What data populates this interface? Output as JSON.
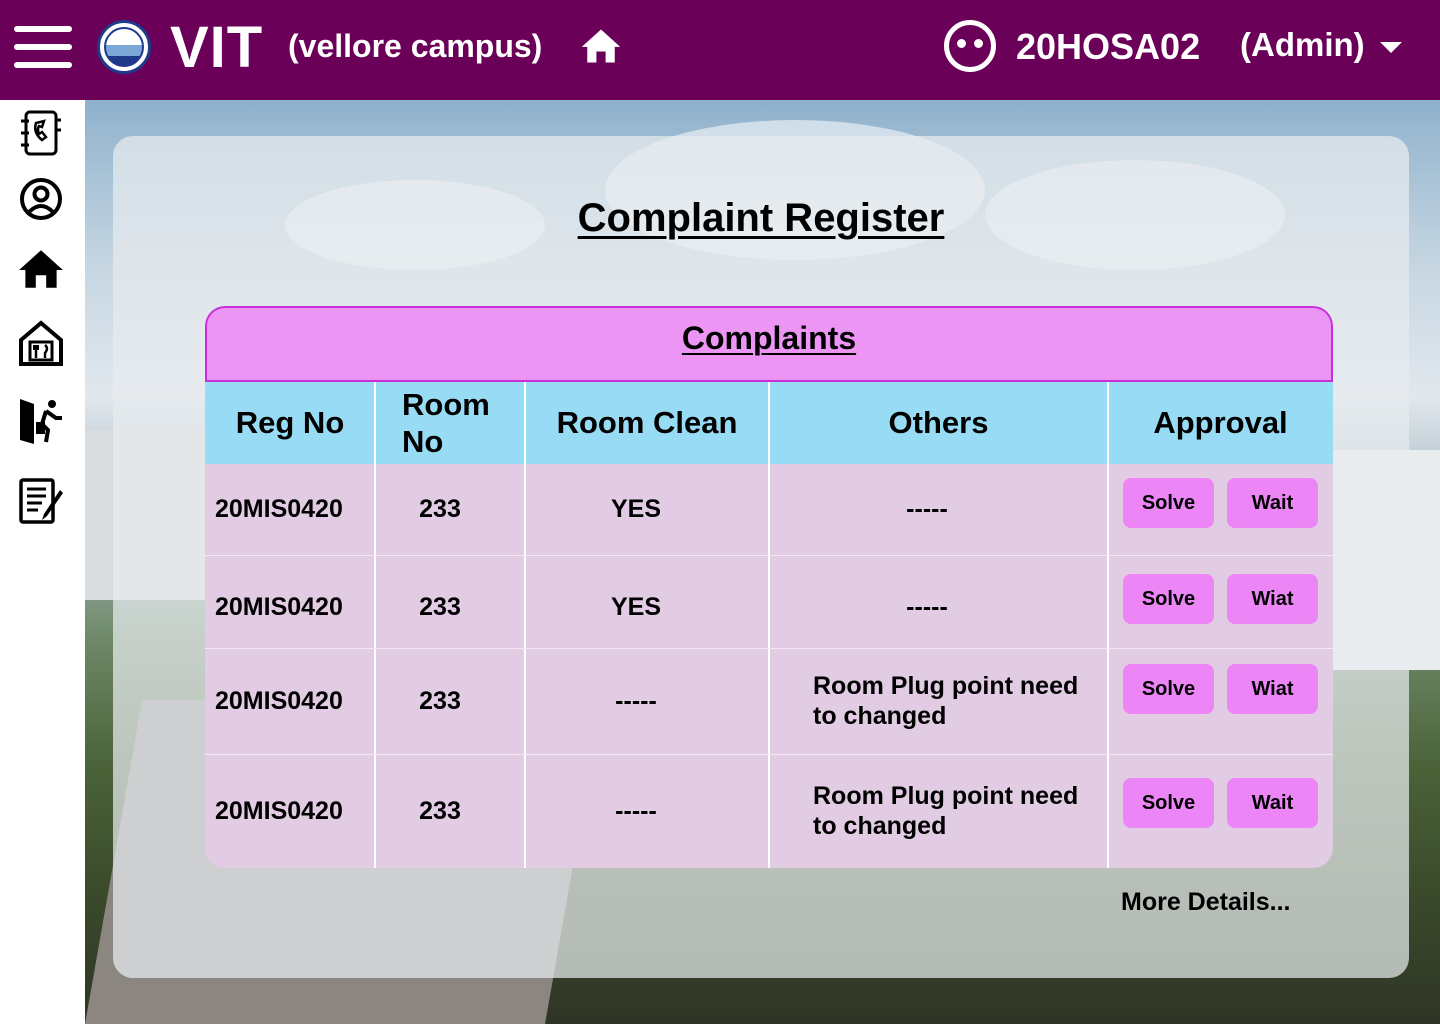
{
  "header": {
    "brand": "VIT",
    "campus": "(vellore campus)",
    "user_id": "20HOSA02",
    "user_role": "(Admin)",
    "background_color": "#6b0059"
  },
  "icons": {
    "menu": "hamburger-menu-icon",
    "logo": "vit-logo-seal",
    "home": "home-icon",
    "user": "user-face-icon",
    "dropdown": "chevron-down-icon"
  },
  "sidebar": {
    "items": [
      {
        "icon": "contacts-book-icon"
      },
      {
        "icon": "user-profile-icon"
      },
      {
        "icon": "home-icon"
      },
      {
        "icon": "mess-dining-icon"
      },
      {
        "icon": "leave-exit-icon"
      },
      {
        "icon": "complaint-form-icon"
      }
    ]
  },
  "main": {
    "title": "Complaint Register",
    "table": {
      "caption": "Complaints",
      "columns": [
        "Reg No",
        "Room No",
        "Room Clean",
        "Others",
        "Approval"
      ],
      "rows": [
        {
          "reg_no": "20MIS0420",
          "room_no": "233",
          "room_clean": "YES",
          "others": "-----",
          "solve_label": "Solve",
          "wait_label": "Wait"
        },
        {
          "reg_no": "20MIS0420",
          "room_no": "233",
          "room_clean": "YES",
          "others": "-----",
          "solve_label": "Solve",
          "wait_label": "Wiat"
        },
        {
          "reg_no": "20MIS0420",
          "room_no": "233",
          "room_clean": "-----",
          "others": "Room Plug point need to changed",
          "solve_label": "Solve",
          "wait_label": "Wiat"
        },
        {
          "reg_no": "20MIS0420",
          "room_no": "233",
          "room_clean": "-----",
          "others": "Room Plug point need to changed",
          "solve_label": "Solve",
          "wait_label": "Wait"
        }
      ]
    },
    "more_details": "More Details..."
  },
  "colors": {
    "header_bg": "#6b0059",
    "caption_bg": "#ec95f5",
    "table_head_bg": "#8dddf6",
    "table_body_bg": "#e2cce4",
    "button_bg": "#ec86f7"
  }
}
